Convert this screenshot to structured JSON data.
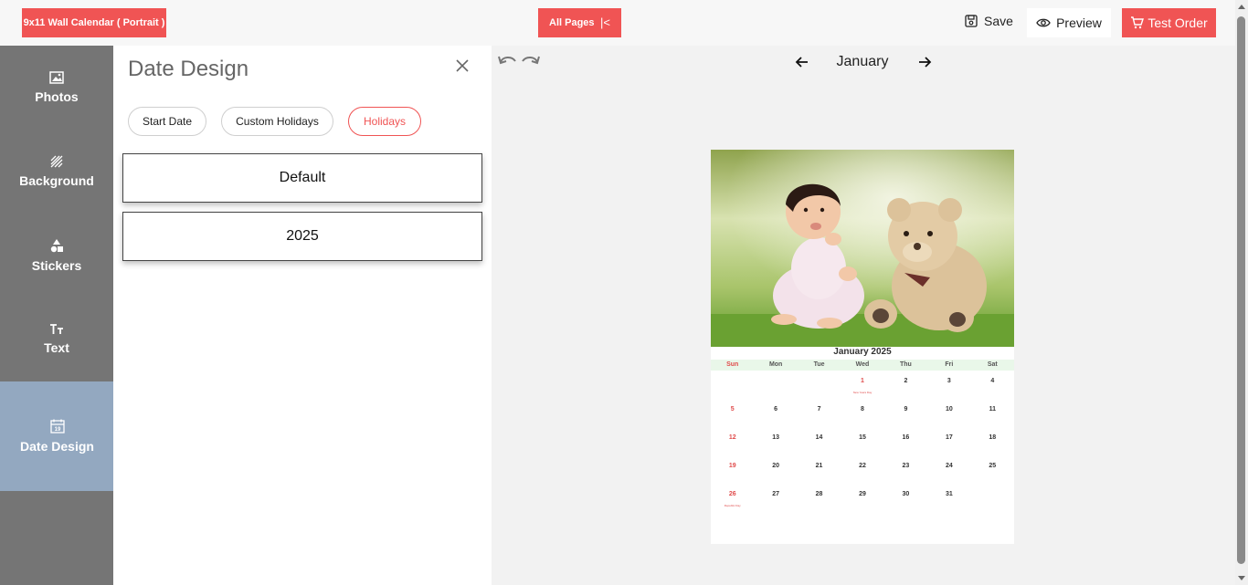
{
  "topbar": {
    "product_label": "9x11 Wall Calendar ( Portrait )",
    "pages_label": "All Pages",
    "pages_collapse_icon": "|<",
    "save_label": "Save",
    "preview_label": "Preview",
    "order_label": "Test Order"
  },
  "sidebar": {
    "items": [
      {
        "label": "Photos",
        "icon": "image-icon"
      },
      {
        "label": "Background",
        "icon": "pattern-icon"
      },
      {
        "label": "Stickers",
        "icon": "shapes-icon"
      },
      {
        "label": "Text",
        "icon": "text-icon"
      },
      {
        "label": "Date Design",
        "icon": "calendar-icon",
        "active": true
      }
    ]
  },
  "panel": {
    "title": "Date Design",
    "tabs": [
      {
        "label": "Start Date"
      },
      {
        "label": "Custom Holidays"
      },
      {
        "label": "Holidays",
        "active": true
      }
    ],
    "options": [
      {
        "label": "Default"
      },
      {
        "label": "2025"
      }
    ]
  },
  "canvas": {
    "month": "January",
    "calendar": {
      "title": "January 2025",
      "weekdays": [
        "Sun",
        "Mon",
        "Tue",
        "Wed",
        "Thu",
        "Fri",
        "Sat"
      ],
      "rows": [
        [
          "",
          "",
          "",
          "1",
          "2",
          "3",
          "4"
        ],
        [
          "5",
          "6",
          "7",
          "8",
          "9",
          "10",
          "11"
        ],
        [
          "12",
          "13",
          "14",
          "15",
          "16",
          "17",
          "18"
        ],
        [
          "19",
          "20",
          "21",
          "22",
          "23",
          "24",
          "25"
        ],
        [
          "26",
          "27",
          "28",
          "29",
          "30",
          "31",
          ""
        ]
      ],
      "holidays": {
        "1": "New Years Day",
        "26": "Republic Day"
      }
    }
  },
  "colors": {
    "accent": "#f05454",
    "sidebar_bg": "#757575",
    "sidebar_active": "#93a8c0",
    "weekday_bar": "#e9f7e9"
  }
}
